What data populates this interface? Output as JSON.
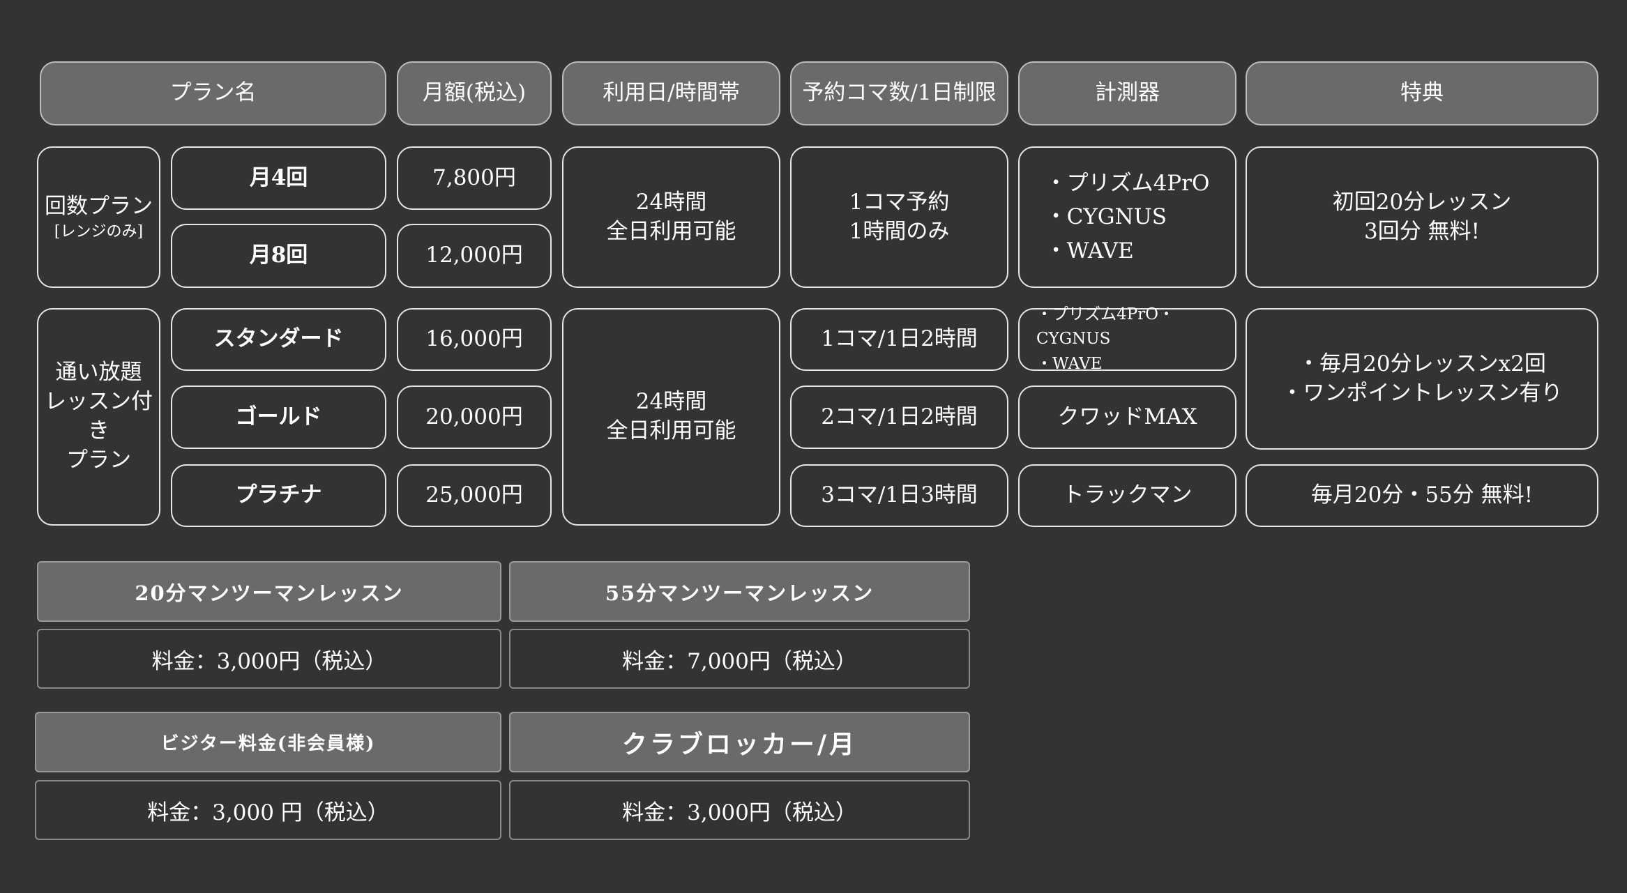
{
  "headers": {
    "plan_name": "プラン名",
    "monthly": "月額(税込)",
    "usage": "利用日/時間帯",
    "reserve": "予約コマ数/1日制限",
    "device": "計測器",
    "perk": "特典"
  },
  "count_plan": {
    "group_label": "回数プラン",
    "group_sub": "[レンジのみ]",
    "plans": [
      {
        "name": "月4回",
        "price": "7,800円"
      },
      {
        "name": "月8回",
        "price": "12,000円"
      }
    ],
    "usage": [
      "24時間",
      "全日利用可能"
    ],
    "reserve": [
      "1コマ予約",
      "1時間のみ"
    ],
    "devices": [
      "・プリズム4PrO",
      "・CYGNUS",
      "・WAVE"
    ],
    "perk": [
      "初回20分レッスン",
      "3回分 無料!"
    ]
  },
  "unlimited_plan": {
    "group_label": [
      "通い放題",
      "レッスン付き",
      "プラン"
    ],
    "plans": [
      {
        "name": "スタンダード",
        "price": "16,000円",
        "reserve": "1コマ/1日2時間"
      },
      {
        "name": "ゴールド",
        "price": "20,000円",
        "reserve": "2コマ/1日2時間",
        "device": "クワッドMAX"
      },
      {
        "name": "プラチナ",
        "price": "25,000円",
        "reserve": "3コマ/1日3時間",
        "device": "トラックマン",
        "perk": "毎月20分・55分 無料!"
      }
    ],
    "usage": [
      "24時間",
      "全日利用可能"
    ],
    "standard_devices": [
      "・プリズム4PrO・CYGNUS",
      "・WAVE"
    ],
    "shared_perk": [
      "・毎月20分レッスンx2回",
      "・ワンポイントレッスン有り"
    ]
  },
  "extras": {
    "lesson20": {
      "title": "20分マンツーマンレッスン",
      "price": "料金：3,000円（税込）"
    },
    "lesson55": {
      "title": "55分マンツーマンレッスン",
      "price": "料金：7,000円（税込）"
    },
    "visitor": {
      "title": "ビジター料金(非会員様)",
      "price": "料金：3,000 円（税込）"
    },
    "locker": {
      "title": "クラブロッカー/月",
      "price": "料金：3,000円（税込）"
    }
  },
  "colors": {
    "background": "#333333",
    "header_fill": "#6a6a6a",
    "border": "#e6e6e6",
    "text": "#ffffff"
  }
}
